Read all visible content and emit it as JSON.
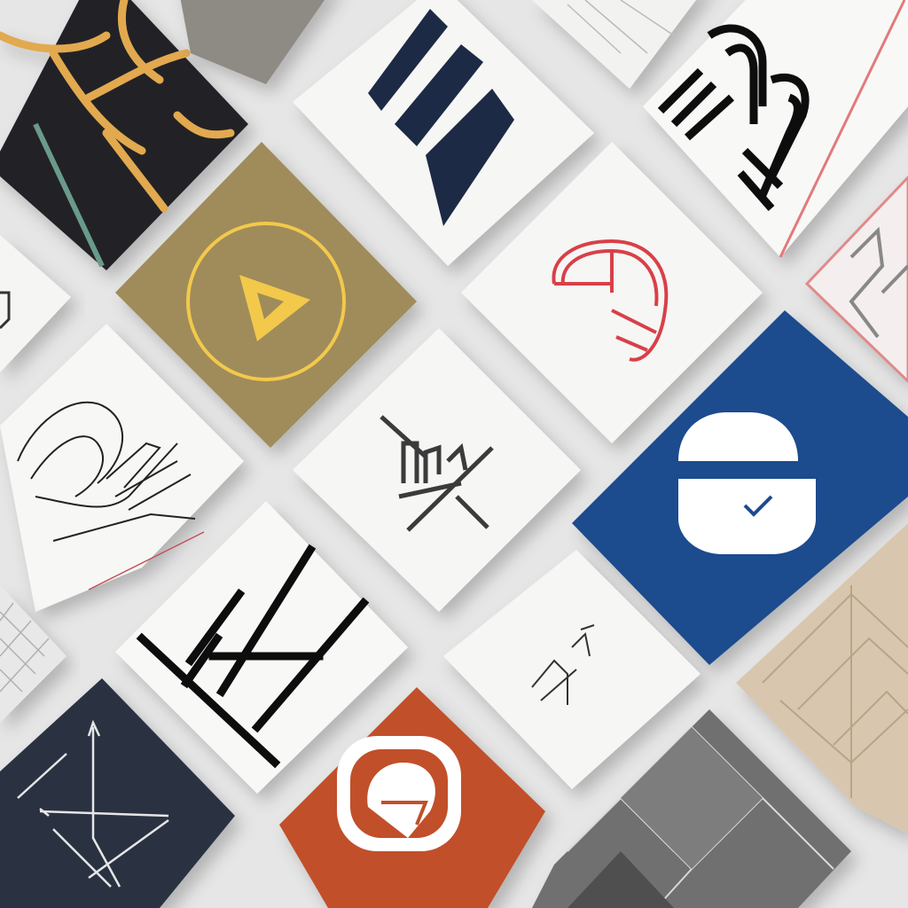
{
  "scene": {
    "background": "#e6e6e6",
    "description_kind": "flat-lay of square logo cards on a light surface"
  },
  "cards": [
    {
      "name": "card-dark-gold-antlers",
      "bg": "#222428",
      "logo": "gold-branch-icon",
      "accent": "#e2a94f"
    },
    {
      "name": "card-gray-felt",
      "bg": "#8e8a84",
      "logo": "none"
    },
    {
      "name": "card-white-navy-stripes",
      "bg": "#f6f6f4",
      "logo": "navy-parallelogram-icon",
      "accent": "#1e2a44"
    },
    {
      "name": "card-white-tile-pattern",
      "bg": "#f2f2f0",
      "logo": "tile-pattern-icon"
    },
    {
      "name": "card-white-maze-letters",
      "bg": "#f8f8f6",
      "logo": "maze-letter-icon",
      "accent": "#111111"
    },
    {
      "name": "card-gold-play-circle",
      "bg": "#a08c5a",
      "logo": "play-triangle-icon",
      "accent": "#f2c94c"
    },
    {
      "name": "card-white-red-arch",
      "bg": "#f6f6f4",
      "logo": "red-arch-icon",
      "accent": "#d8414a"
    },
    {
      "name": "card-white-outline-letters",
      "bg": "#f7f7f5",
      "logo": "outline-letter-icon",
      "accent": "#222222"
    },
    {
      "name": "card-white-ge-monogram",
      "bg": "#f6f6f4",
      "logo": "monogram-icon",
      "accent": "#333333"
    },
    {
      "name": "card-white-hash-symbol",
      "bg": "#f6f6f4",
      "logo": "hash-symbol-icon",
      "accent": "#555555"
    },
    {
      "name": "card-blue-capsule",
      "bg": "#1d4c8e",
      "logo": "capsule-icon",
      "accent": "#ffffff"
    },
    {
      "name": "card-white-bold-k",
      "bg": "#f8f8f6",
      "logo": "bold-k-icon",
      "accent": "#111111"
    },
    {
      "name": "card-white-small-mark",
      "bg": "#f6f6f4",
      "logo": "small-line-mark-icon",
      "accent": "#333333"
    },
    {
      "name": "card-beige-geometric",
      "bg": "#d8c7ae",
      "logo": "geometric-pattern-icon"
    },
    {
      "name": "card-navy-arrow-k",
      "bg": "#2a3142",
      "logo": "arrow-k-icon",
      "accent": "#e6e6e6"
    },
    {
      "name": "card-orange-badge",
      "bg": "#c1502a",
      "logo": "orange-badge-icon",
      "accent": "#ffffff"
    },
    {
      "name": "card-gray-slate-tiles",
      "bg": "#6f6f6f",
      "logo": "slate-tiles-icon"
    },
    {
      "name": "card-white-red-frame",
      "bg": "#f4eeee",
      "logo": "red-frame-icon",
      "accent": "#e08a8a"
    },
    {
      "name": "card-white-left-mark",
      "bg": "#f5f5f3",
      "logo": "left-mark-icon",
      "accent": "#333333"
    },
    {
      "name": "card-white-grid-pattern",
      "bg": "#e8e8e8",
      "logo": "grid-pattern-icon"
    }
  ]
}
